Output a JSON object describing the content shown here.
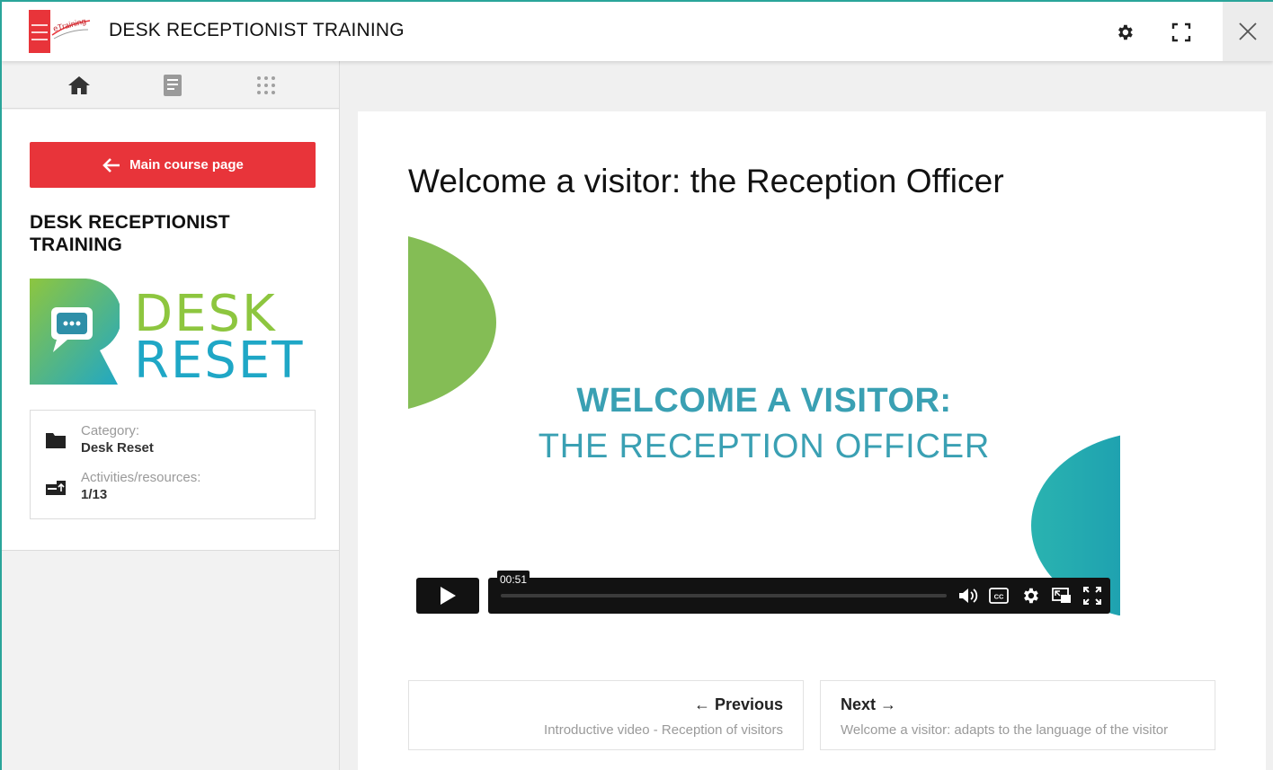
{
  "app": {
    "title": "DESK RECEPTIONIST TRAINING",
    "logo_text": "eTraining"
  },
  "toolbar": {
    "settings_icon": "gear-icon",
    "fullscreen_icon": "expand-icon",
    "close_icon": "close-icon"
  },
  "sidebar": {
    "nav_icons": [
      "home-icon",
      "book-icon",
      "grid-icon"
    ],
    "main_course_label": "Main course page",
    "course_title": "DESK RECEPTIONIST TRAINING",
    "course_logo": {
      "line1": "DESK",
      "line2": "RESET"
    },
    "info": {
      "category_label": "Category:",
      "category_value": "Desk Reset",
      "activities_label": "Activities/resources:",
      "activities_value": "1/13"
    }
  },
  "content": {
    "title": "Welcome a visitor: the Reception Officer",
    "video": {
      "title_line1": "WELCOME A VISITOR:",
      "title_line2": "THE RECEPTION OFFICER",
      "time": "00:51",
      "progress": 0.0
    },
    "previous": {
      "label": "← Previous",
      "subtitle": "Introductive video - Reception of visitors"
    },
    "next": {
      "label": "Next →",
      "subtitle": "Welcome a visitor: adapts to the language of the visitor"
    }
  },
  "colors": {
    "accent_red": "#e8343a",
    "frame_teal": "#2aa59a",
    "video_text": "#3aa0b3",
    "logo_green": "#8dc63f",
    "logo_blue": "#1fa7c6"
  }
}
